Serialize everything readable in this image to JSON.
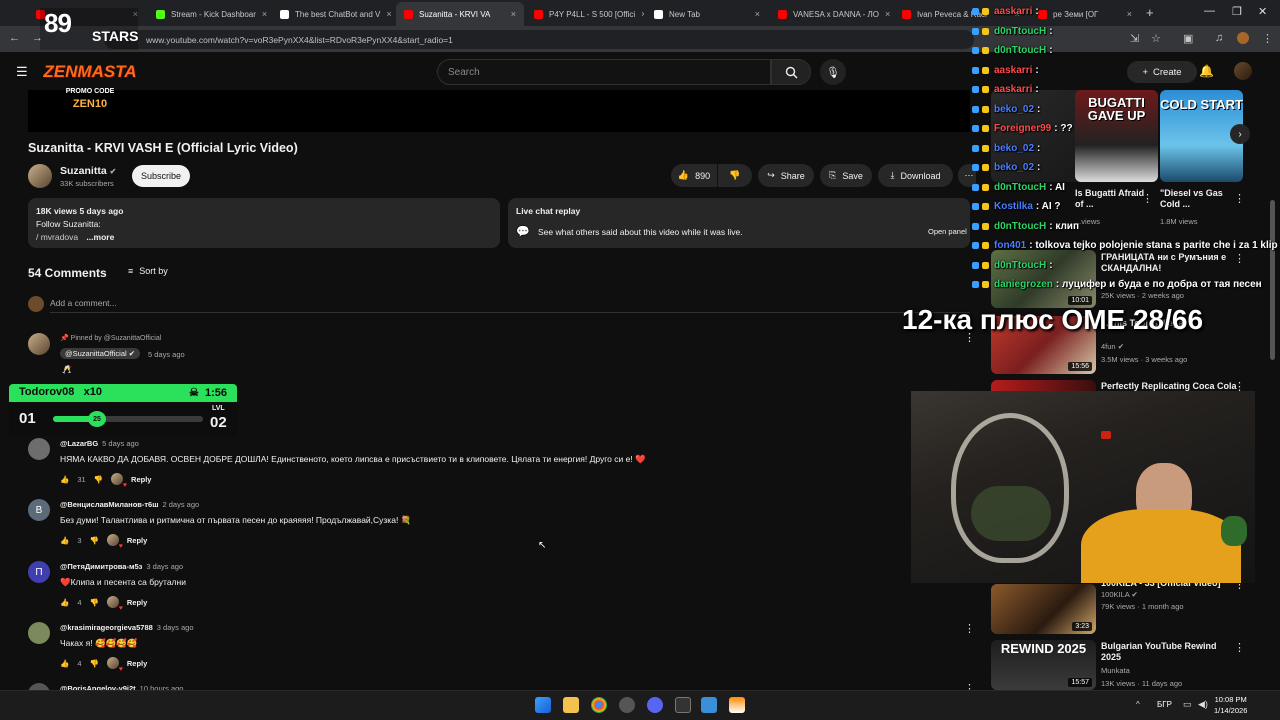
{
  "browser": {
    "tabs": [
      {
        "label": "",
        "color": "#ff0000"
      },
      {
        "label": "Stream - Kick Dashboar",
        "color": "#53fc18"
      },
      {
        "label": "The best ChatBot and V",
        "color": "#ffffff"
      },
      {
        "label": "Suzanitta - KRVI VA",
        "color": "#ff0000"
      },
      {
        "label": "P4Y P4LL - S 500 [Offici",
        "color": "#ff0000"
      },
      {
        "label": "New Tab",
        "color": "#ffffff"
      },
      {
        "label": "VANESA x DANNA - ЛО",
        "color": "#ff0000"
      },
      {
        "label": "Ivan Peveca & Raci",
        "color": "#ff0000"
      },
      {
        "label": "ре Земи [ОГ",
        "color": "#ff0000"
      }
    ],
    "url": "www.youtube.com/watch?v=voR3ePynXX4&list=RDvoR3ePynXX4&start_radio=1"
  },
  "youtube": {
    "search_placeholder": "Search",
    "create_label": "Create",
    "video": {
      "title": "Suzanitta - KRVI VASH E (Official Lyric Video)",
      "channel": "Suzanitta",
      "subscribers": "33K subscribers",
      "subscribe_label": "Subscribe",
      "likes": "890",
      "share_label": "Share",
      "save_label": "Save",
      "download_label": "Download"
    },
    "description": {
      "meta": "18K views  5 days ago",
      "line1": "Follow Suzanitta:",
      "line2": "/ mvradova",
      "more": "...more"
    },
    "live_chat": {
      "title": "Live chat replay",
      "text": "See what others said about this video while it was live.",
      "open_label": "Open panel"
    },
    "comments": {
      "count": "54 Comments",
      "sort_label": "Sort by",
      "add_placeholder": "Add a comment...",
      "pinned": {
        "pinned_by": "Pinned by @SuzanittaOfficial",
        "author": "@SuzanittaOfficial",
        "ago": "5 days ago",
        "text": "🥂"
      },
      "items": [
        {
          "author": "@LazarBG",
          "ago": "5 days ago",
          "text": "НЯМА КАКВО ДА ДОБАВЯ. ОСВЕН ДОБРЕ ДОШЛА! Единственото, което липсва е присъствието ти в клиповете. Цялата ти енергия! Друго си е! ❤️",
          "likes": "31",
          "avatar_letter": "",
          "avatar_color": "#6d6d6d"
        },
        {
          "author": "@ВенциславМиланов-т6ш",
          "ago": "2 days ago",
          "text": "Без думи! Талантлива и ритмична от първата песен до краяяяя! Продължавай,Сузка! 💐",
          "likes": "3",
          "avatar_letter": "В",
          "avatar_color": "#5c6b7a"
        },
        {
          "author": "@ПетяДимитрова-м5з",
          "ago": "3 days ago",
          "text": "❤️Клипа и песента са брутални",
          "likes": "4",
          "avatar_letter": "П",
          "avatar_color": "#3f3fb0"
        },
        {
          "author": "@krasimirageorgieva5788",
          "ago": "3 days ago",
          "text": "Чаках я! 🥰🥰🥰🥰",
          "likes": "4",
          "avatar_letter": "",
          "avatar_color": "#7a8a5c"
        },
        {
          "author": "@BorisAngelov-y9i2t",
          "ago": "10 hours ago",
          "text": "",
          "likes": "",
          "avatar_letter": "",
          "avatar_color": "#555555"
        }
      ],
      "reply_label": "Reply"
    },
    "sidebar": {
      "shorts": [
        {
          "overlay": "BUGATTI GAVE UP",
          "title": "Is Bugatti Afraid of ...",
          "views": "...views"
        },
        {
          "overlay": "COLD START",
          "title": "\"Diesel vs Gas Cold ...",
          "views": "1.8M views"
        }
      ],
      "videos": [
        {
          "title": "ГРАНИЦАТА ни с Румъния е СКАНДАЛНА!",
          "channel": "",
          "meta": "25K views · 2 weeks ago",
          "duration": "10:01"
        },
        {
          "title": "...This Tool Is Illegal",
          "channel": "4fun",
          "meta": "3.5M views · 3 weeks ago",
          "duration": "15:56"
        },
        {
          "title": "Perfectly Replicating Coca Cola",
          "channel": "",
          "meta": "",
          "duration": ""
        },
        {
          "title": "100KILA - 33 [Official Video]",
          "channel": "100KILA",
          "meta": "79K views · 1 month ago",
          "duration": "3:23"
        },
        {
          "title": "Bulgarian YouTube Rewind 2025",
          "channel": "Munkata",
          "meta": "13K views · 11 days ago",
          "duration": "15:57"
        }
      ]
    }
  },
  "stream_overlay": {
    "logo_number": "89",
    "logo_text": "STARS",
    "promo_brand": "ZENMASTA",
    "promo_sub": "PROMO CODE",
    "promo_code": "ZEN10",
    "level": {
      "user": "Todorov08",
      "multiplier": "x10",
      "timer": "1:56",
      "current": "01",
      "next": "02",
      "next_label": "LVL",
      "progress_value": "25"
    },
    "chat": [
      {
        "user": "aaskarri",
        "msg": ":",
        "color": "#ff4b4b"
      },
      {
        "user": "d0nTtoucH",
        "msg": ":",
        "color": "#2bd467"
      },
      {
        "user": "d0nTtoucH",
        "msg": ":",
        "color": "#2bd467"
      },
      {
        "user": "aaskarri",
        "msg": ":",
        "color": "#ff4b4b"
      },
      {
        "user": "aaskarri",
        "msg": ":",
        "color": "#ff4b4b"
      },
      {
        "user": "beko_02",
        "msg": ":",
        "color": "#4a7dff"
      },
      {
        "user": "Foreigner99",
        "msg": ": ??",
        "color": "#ff4b4b"
      },
      {
        "user": "beko_02",
        "msg": ":",
        "color": "#4a7dff"
      },
      {
        "user": "beko_02",
        "msg": ":",
        "color": "#4a7dff"
      },
      {
        "user": "d0nTtoucH",
        "msg": ": AI",
        "color": "#2bd467"
      },
      {
        "user": "Kostilka",
        "msg": ": AI ?",
        "color": "#4a7dff"
      },
      {
        "user": "d0nTtoucH",
        "msg": ": клип",
        "color": "#2bd467"
      },
      {
        "user": "fon401",
        "msg": ": tolkova tejko polojenie stana s parite che i za 1 klip",
        "color": "#4a7dff"
      },
      {
        "user": "d0nTtoucH",
        "msg": ":",
        "color": "#2bd467"
      },
      {
        "user": "daniegrozen",
        "msg": ": луцифер и буда е по добра от тая песен",
        "color": "#2bd467"
      }
    ],
    "banner": "12-ка плюс ОМЕ 28/66"
  },
  "taskbar": {
    "lang": "БГР",
    "time": "10:08 PM",
    "date": "1/14/2026"
  }
}
